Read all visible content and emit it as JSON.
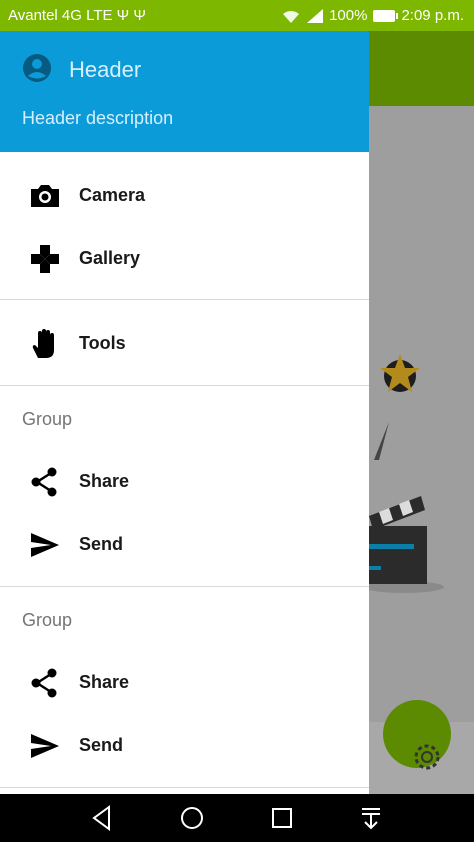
{
  "status": {
    "carrier": "Avantel 4G LTE Ψ Ψ",
    "battery": "100%",
    "time": "2:09 p.m."
  },
  "drawer": {
    "header_title": "Header",
    "header_description": "Header description",
    "items": [
      {
        "label": "Camera",
        "icon": "camera-icon"
      },
      {
        "label": "Gallery",
        "icon": "gallery-icon"
      },
      {
        "label": "Tools",
        "icon": "tools-icon"
      }
    ],
    "groups": [
      {
        "title": "Group",
        "items": [
          {
            "label": "Share",
            "icon": "share-icon"
          },
          {
            "label": "Send",
            "icon": "send-icon"
          }
        ]
      },
      {
        "title": "Group",
        "items": [
          {
            "label": "Share",
            "icon": "share-icon"
          },
          {
            "label": "Send",
            "icon": "send-icon"
          }
        ]
      }
    ]
  },
  "colors": {
    "status_bar": "#7db700",
    "header": "#0a9bd8",
    "toolbar_dimmed": "#5c8a00"
  }
}
